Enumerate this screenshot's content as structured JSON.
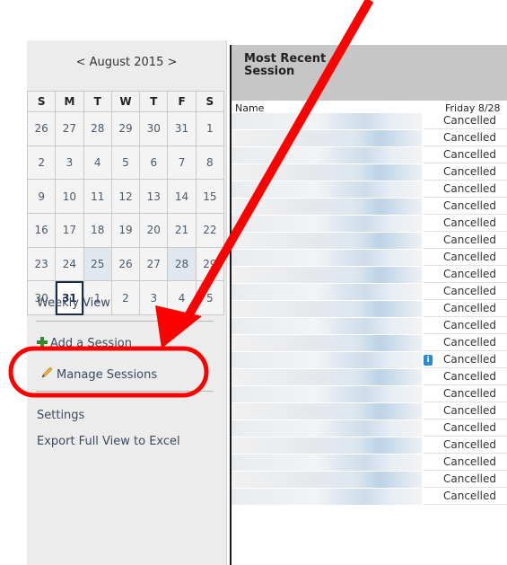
{
  "calendar": {
    "month_label": "August 2015",
    "prev": "<",
    "next": ">",
    "weekdays": [
      "S",
      "M",
      "T",
      "W",
      "T",
      "F",
      "S"
    ],
    "weeks": [
      [
        "26",
        "27",
        "28",
        "29",
        "30",
        "31",
        "1"
      ],
      [
        "2",
        "3",
        "4",
        "5",
        "6",
        "7",
        "8"
      ],
      [
        "9",
        "10",
        "11",
        "12",
        "13",
        "14",
        "15"
      ],
      [
        "16",
        "17",
        "18",
        "19",
        "20",
        "21",
        "22"
      ],
      [
        "23",
        "24",
        "25",
        "26",
        "27",
        "28",
        "29"
      ],
      [
        "30",
        "31",
        "1",
        "2",
        "3",
        "4",
        "5"
      ]
    ],
    "today": "31"
  },
  "nav": {
    "weekly_view": "Weekly View",
    "add_session": "Add a Session",
    "manage_sessions": "Manage Sessions",
    "settings": "Settings",
    "export": "Export Full View to Excel"
  },
  "panel": {
    "title": "Most Recent Session",
    "col_name": "Name",
    "col_date": "Friday 8/28"
  },
  "rows": [
    {
      "status": "Cancelled"
    },
    {
      "status": "Cancelled"
    },
    {
      "status": "Cancelled"
    },
    {
      "status": "Cancelled"
    },
    {
      "status": "Cancelled"
    },
    {
      "status": "Cancelled"
    },
    {
      "status": "Cancelled"
    },
    {
      "status": "Cancelled"
    },
    {
      "status": "Cancelled"
    },
    {
      "status": "Cancelled"
    },
    {
      "status": "Cancelled"
    },
    {
      "status": "Cancelled"
    },
    {
      "status": "Cancelled"
    },
    {
      "status": "Cancelled"
    },
    {
      "status": "Cancelled"
    },
    {
      "status": "Cancelled"
    },
    {
      "status": "Cancelled"
    },
    {
      "status": "Cancelled"
    },
    {
      "status": "Cancelled"
    },
    {
      "status": "Cancelled"
    },
    {
      "status": "Cancelled"
    },
    {
      "status": "Cancelled"
    },
    {
      "status": "Cancelled"
    }
  ],
  "info_badge": "i",
  "colors": {
    "annotation_red": "#ff0000",
    "header_gray": "#c6c6c6",
    "sidebar_gray": "#ececec"
  }
}
